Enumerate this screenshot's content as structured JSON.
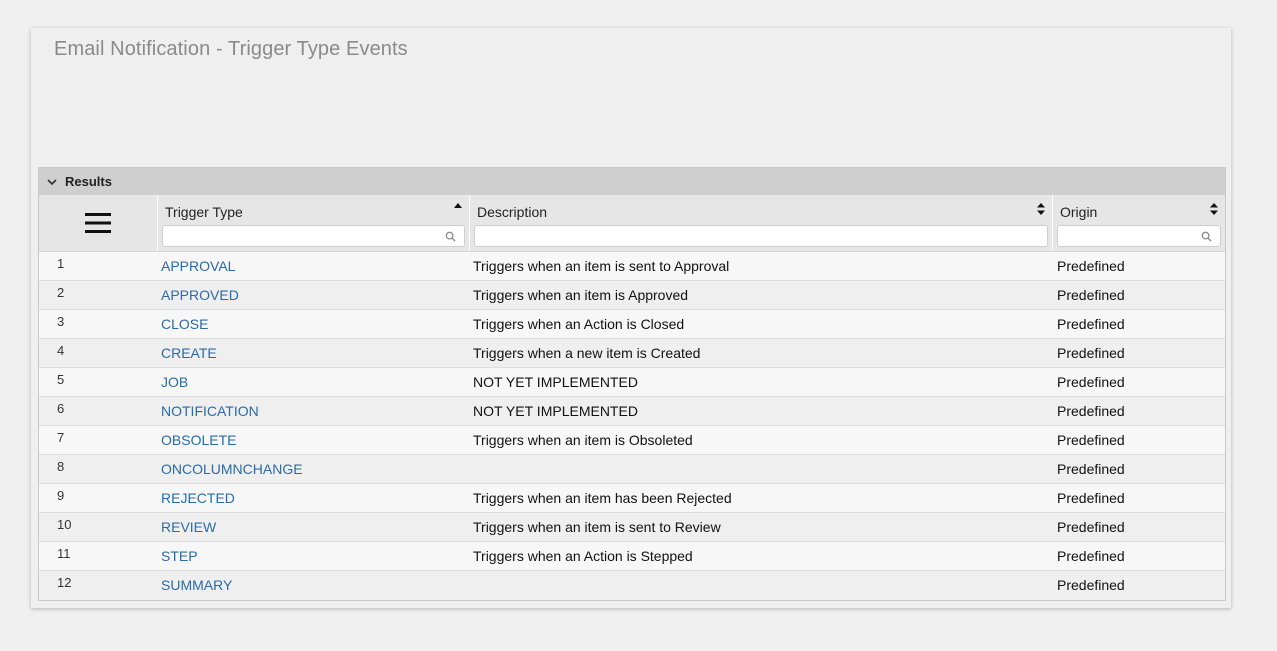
{
  "page": {
    "title": "Email Notification - Trigger Type Events"
  },
  "results": {
    "label": "Results"
  },
  "columns": {
    "trigger_type": "Trigger Type",
    "description": "Description",
    "origin": "Origin"
  },
  "filters": {
    "trigger_type_value": "",
    "description_value": "",
    "origin_value": ""
  },
  "rows": [
    {
      "num": "1",
      "type": "APPROVAL",
      "description": "Triggers when an item is sent to Approval",
      "origin": "Predefined"
    },
    {
      "num": "2",
      "type": "APPROVED",
      "description": "Triggers when an item is Approved",
      "origin": "Predefined"
    },
    {
      "num": "3",
      "type": "CLOSE",
      "description": "Triggers when an Action is Closed",
      "origin": "Predefined"
    },
    {
      "num": "4",
      "type": "CREATE",
      "description": "Triggers when a new item is Created",
      "origin": "Predefined"
    },
    {
      "num": "5",
      "type": "JOB",
      "description": "NOT YET IMPLEMENTED",
      "origin": "Predefined"
    },
    {
      "num": "6",
      "type": "NOTIFICATION",
      "description": "NOT YET IMPLEMENTED",
      "origin": "Predefined"
    },
    {
      "num": "7",
      "type": "OBSOLETE",
      "description": "Triggers when an item is Obsoleted",
      "origin": "Predefined"
    },
    {
      "num": "8",
      "type": "ONCOLUMNCHANGE",
      "description": "",
      "origin": "Predefined"
    },
    {
      "num": "9",
      "type": "REJECTED",
      "description": "Triggers when an item has been Rejected",
      "origin": "Predefined"
    },
    {
      "num": "10",
      "type": "REVIEW",
      "description": "Triggers when an item is sent to Review",
      "origin": "Predefined"
    },
    {
      "num": "11",
      "type": "STEP",
      "description": "Triggers when an Action is Stepped",
      "origin": "Predefined"
    },
    {
      "num": "12",
      "type": "SUMMARY",
      "description": "",
      "origin": "Predefined"
    }
  ],
  "colors": {
    "link": "#2a6aa8",
    "title": "#8a8a8a",
    "results_bar": "#cfcfcf",
    "header_bg": "#e6e6e6"
  },
  "icons": {
    "collapse": "chevron-down-icon",
    "menu": "hamburger-menu-icon",
    "sort_asc": "sort-ascending-icon",
    "sort": "sort-icon",
    "search": "search-icon"
  }
}
